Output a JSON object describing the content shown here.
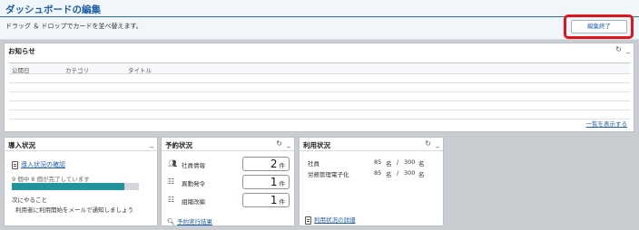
{
  "header": {
    "title": "ダッシュボードの編集",
    "subtitle": "ドラッグ ＆ ドロップでカードを並べ替えます。",
    "finish_button": "編集終了"
  },
  "news": {
    "title": "お知らせ",
    "columns": [
      "公開日",
      "カテゴリ",
      "タイトル"
    ],
    "more_link": "一覧を表示する"
  },
  "onboarding": {
    "title": "導入状況",
    "link": "導入状況の確認",
    "progress_text": "9 個中 8 個が完了しています",
    "progress_fraction": 0.889,
    "next_label": "次にやること",
    "next_item": "利用者に利用開始をメールで通知しましょう"
  },
  "reservation": {
    "title": "予約状況",
    "items": [
      {
        "label": "社員情報",
        "value": "2",
        "unit": "件",
        "icon": "people-icon"
      },
      {
        "label": "異動発令",
        "value": "1",
        "unit": "件",
        "icon": "org-chart-icon"
      },
      {
        "label": "組織改編",
        "value": "1",
        "unit": "件",
        "icon": "hierarchy-icon"
      }
    ],
    "link": "予約実行結果"
  },
  "usage": {
    "title": "利用状況",
    "rows": [
      {
        "label": "社員",
        "count": "85",
        "unit": "名",
        "sep": "/",
        "total": "300",
        "unit2": "名"
      },
      {
        "label": "労務管理電子化",
        "count": "85",
        "unit": "名",
        "sep": "/",
        "total": "300",
        "unit2": "名"
      }
    ],
    "link": "利用状況の詳細"
  },
  "icons": {
    "refresh": "↻",
    "minimize": "_"
  },
  "colors": {
    "title_blue": "#1e5fa8",
    "progress": "#23929a",
    "highlight": "#e0141a"
  }
}
